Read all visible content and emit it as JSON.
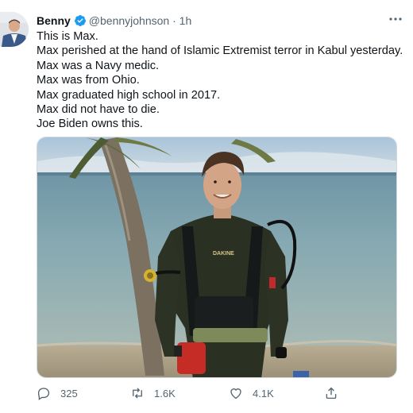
{
  "author": {
    "name": "Benny",
    "handle": "@bennyjohnson",
    "separator": "·",
    "timestamp": "1h"
  },
  "tweet": {
    "lines": [
      "This is Max.",
      "Max perished at the hand of Islamic Extremist terror in Kabul yesterday.",
      "Max was a Navy medic.",
      "Max was from Ohio.",
      "Max graduated high school in 2017.",
      "Max did not have to die.",
      "Joe Biden owns this."
    ]
  },
  "media": {
    "description_icon": "photo",
    "wetsuit_brand": "DAKINE"
  },
  "actions": {
    "reply_count": "325",
    "retweet_count": "1.6K",
    "like_count": "4.1K"
  },
  "icons": {
    "verified": "verified-badge-icon",
    "more": "more-options-icon",
    "reply": "reply-icon",
    "retweet": "retweet-icon",
    "like": "like-icon",
    "share": "share-icon"
  },
  "colors": {
    "verified": "#1d9bf0",
    "text": "#0f1419",
    "muted": "#536471"
  }
}
